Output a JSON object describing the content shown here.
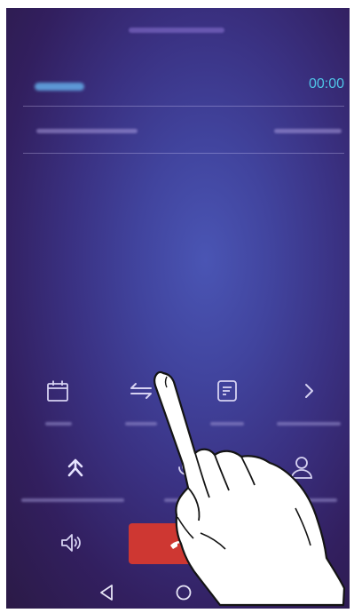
{
  "call": {
    "timer": "00:00"
  },
  "icons": {
    "calendar": "calendar-icon",
    "switch_calls": "swap-arrows-icon",
    "notes": "notes-icon",
    "more": "chevron-right-icon",
    "add_call": "add-call-icon",
    "mute": "microphone-icon",
    "contacts": "contacts-icon",
    "speaker": "speaker-icon",
    "end_call": "end-call-icon"
  },
  "navbar": {
    "back": "back-icon",
    "home": "home-icon",
    "recent": "recent-apps-icon"
  },
  "colors": {
    "accent": "#4fc3e6",
    "end_call": "#ce3732",
    "icon": "#d6d2f2"
  }
}
